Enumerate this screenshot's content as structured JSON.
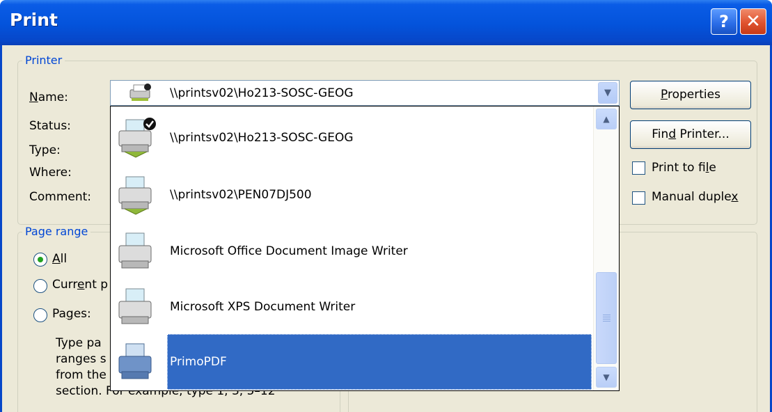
{
  "dialog": {
    "title": "Print",
    "help_glyph": "?",
    "close_glyph": "✕"
  },
  "printer_group": {
    "legend": "Printer",
    "name_label_u": "N",
    "name_label_rest": "ame:",
    "status_label": "Status:",
    "type_label": "Type:",
    "where_label": "Where:",
    "comment_label": "Comment:",
    "selected_printer": "\\\\printsv02\\Ho213-SOSC-GEOG",
    "properties_u": "P",
    "properties_rest": "roperties",
    "find_printer_a": "Fin",
    "find_printer_u": "d",
    "find_printer_b": " Printer...",
    "print_to_file_a": "Print to fi",
    "print_to_file_u": "l",
    "print_to_file_b": "e",
    "manual_duplex_a": "Manual duple",
    "manual_duplex_u": "x"
  },
  "page_range": {
    "legend": "Page range",
    "all_u": "A",
    "all_rest": "ll",
    "current_a": "Curr",
    "current_u": "e",
    "current_b": "nt p",
    "pages_a": "Pa",
    "pages_u": "g",
    "pages_b": "es:",
    "hint_lines": [
      "Type pa",
      "ranges s",
      "from the",
      "section. For example, type 1, 3, 5–12"
    ]
  },
  "dropdown_items": [
    {
      "label": "\\\\printsv02\\Ho213-SOSC-GEOG",
      "icon": "printer-network-default-icon",
      "selected": false
    },
    {
      "label": "\\\\printsv02\\PEN07DJ500",
      "icon": "printer-network-icon",
      "selected": false
    },
    {
      "label": "Microsoft Office Document Image Writer",
      "icon": "printer-icon",
      "selected": false
    },
    {
      "label": "Microsoft XPS Document Writer",
      "icon": "printer-icon",
      "selected": false
    },
    {
      "label": "PrimoPDF",
      "icon": "printer-icon",
      "selected": true
    }
  ],
  "colors": {
    "titlebar": "#0453db",
    "dialog_bg": "#ece9d8",
    "legend_text": "#0046d5",
    "selection": "#316ac5"
  }
}
